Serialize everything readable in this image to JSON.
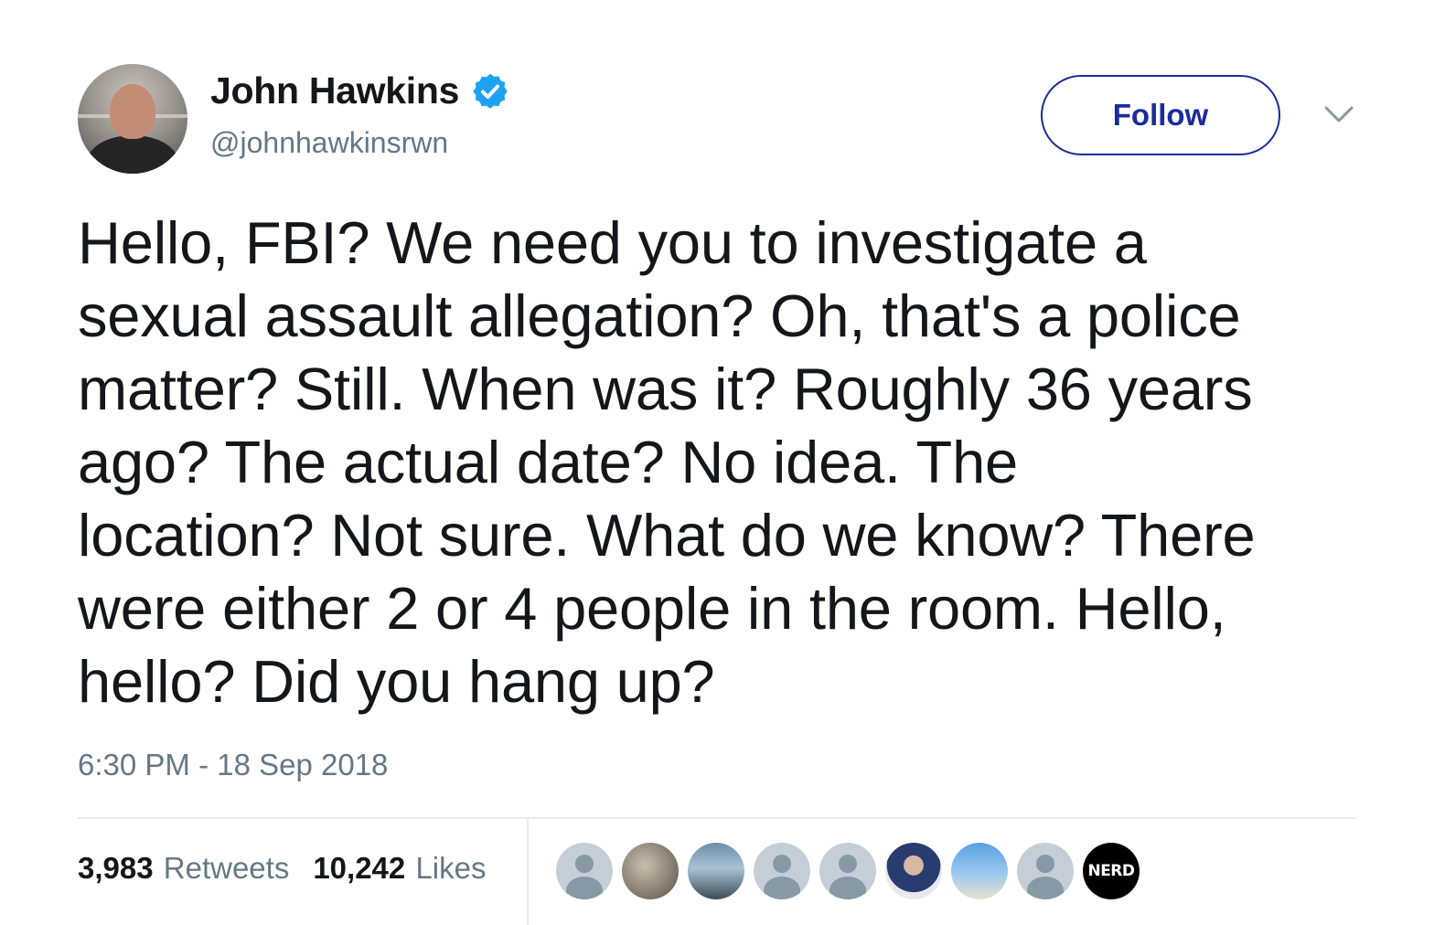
{
  "user": {
    "display_name": "John Hawkins",
    "handle": "@johnhawkinsrwn",
    "verified": true
  },
  "actions": {
    "follow_label": "Follow"
  },
  "tweet": {
    "text": "Hello, FBI? We need you to investigate a\nsexual assault allegation? Oh, that's a police\nmatter? Still. When was it? Roughly 36 years\nago? The actual date? No idea. The\nlocation? Not sure. What do we know? There\nwere either 2 or 4 people in the room. Hello,\nhello? Did you hang up?",
    "timestamp": "6:30 PM - 18 Sep 2018"
  },
  "stats": {
    "retweets_count": "3,983",
    "retweets_label": "Retweets",
    "likes_count": "10,242",
    "likes_label": "Likes"
  },
  "likers": {
    "last_badge_label": "NERD"
  },
  "colors": {
    "text": "#14171a",
    "secondary_text": "#657786",
    "follow_accent": "#1b2b9c",
    "verified_blue": "#1da1f2",
    "divider": "#e6ecf0"
  },
  "icons": {
    "verified": "verified-badge-icon",
    "caret": "chevron-down-icon"
  }
}
